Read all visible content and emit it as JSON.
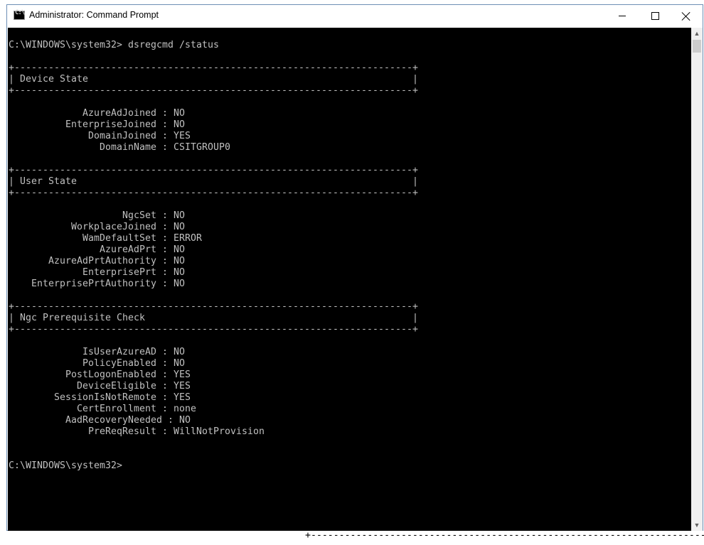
{
  "window": {
    "title": "Administrator: Command Prompt",
    "icon_label": "C:\\"
  },
  "controls": {
    "minimize": "minimize-icon",
    "maximize": "maximize-icon",
    "close": "close-icon"
  },
  "console": {
    "lines": [
      "C:\\WINDOWS\\system32> dsregcmd /status",
      "",
      "+----------------------------------------------------------------------+",
      "| Device State                                                         |",
      "+----------------------------------------------------------------------+",
      "",
      "             AzureAdJoined : NO",
      "          EnterpriseJoined : NO",
      "              DomainJoined : YES",
      "                DomainName : CSITGROUP0",
      "",
      "+----------------------------------------------------------------------+",
      "| User State                                                           |",
      "+----------------------------------------------------------------------+",
      "",
      "                    NgcSet : NO",
      "           WorkplaceJoined : NO",
      "             WamDefaultSet : ERROR",
      "                AzureAdPrt : NO",
      "       AzureAdPrtAuthority : NO",
      "             EnterprisePrt : NO",
      "    EnterprisePrtAuthority : NO",
      "",
      "+----------------------------------------------------------------------+",
      "| Ngc Prerequisite Check                                               |",
      "+----------------------------------------------------------------------+",
      "",
      "             IsUserAzureAD : NO",
      "             PolicyEnabled : NO",
      "          PostLogonEnabled : YES",
      "            DeviceEligible : YES",
      "        SessionIsNotRemote : YES",
      "            CertEnrollment : none",
      "          AadRecoveryNeeded : NO",
      "              PreReqResult : WillNotProvision",
      "",
      "",
      "C:\\WINDOWS\\system32>"
    ]
  },
  "behind_window": {
    "separator": "+----------------------------------------------------------------------+"
  },
  "scrollbar": {
    "up": "▲",
    "down": "▼"
  }
}
